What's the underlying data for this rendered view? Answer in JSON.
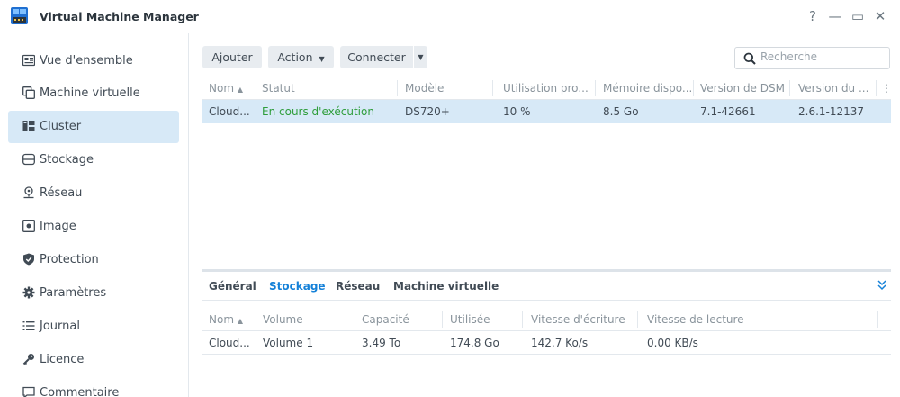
{
  "app": {
    "title": "Virtual Machine Manager"
  },
  "window_controls": {
    "help": "?",
    "minimize": "—",
    "maximize": "▭",
    "close": "✕"
  },
  "sidebar": {
    "items": [
      {
        "label": "Vue d'ensemble",
        "icon": "overview-icon"
      },
      {
        "label": "Machine virtuelle",
        "icon": "vm-icon"
      },
      {
        "label": "Cluster",
        "icon": "cluster-icon",
        "active": true
      },
      {
        "label": "Stockage",
        "icon": "storage-icon"
      },
      {
        "label": "Réseau",
        "icon": "network-icon"
      },
      {
        "label": "Image",
        "icon": "image-icon"
      },
      {
        "label": "Protection",
        "icon": "shield-icon"
      },
      {
        "label": "Paramètres",
        "icon": "gear-icon"
      },
      {
        "label": "Journal",
        "icon": "list-icon"
      },
      {
        "label": "Licence",
        "icon": "key-icon"
      },
      {
        "label": "Commentaire",
        "icon": "comment-icon"
      }
    ]
  },
  "toolbar": {
    "add_label": "Ajouter",
    "action_label": "Action",
    "connect_label": "Connecter",
    "search_placeholder": "Recherche"
  },
  "cluster_table": {
    "columns": [
      "Nom",
      "Statut",
      "Modèle",
      "Utilisation pro...",
      "Mémoire dispo...",
      "Version de DSM",
      "Version du ..."
    ],
    "rows": [
      [
        "Cloud...",
        "En cours d'exécution",
        "DS720+",
        "10 %",
        "8.5 Go",
        "7.1-42661",
        "2.6.1-12137"
      ]
    ]
  },
  "detail_tabs": [
    "Général",
    "Stockage",
    "Réseau",
    "Machine virtuelle"
  ],
  "active_detail_tab": "Stockage",
  "storage_table": {
    "columns": [
      "Nom",
      "Volume",
      "Capacité",
      "Utilisée",
      "Vitesse d'écriture",
      "Vitesse de lecture"
    ],
    "rows": [
      [
        "Cloud...",
        "Volume 1",
        "3.49 To",
        "174.8 Go",
        "142.7 Ko/s",
        "0.00 KB/s"
      ]
    ]
  },
  "colors": {
    "accent": "#1581d8",
    "selected_row": "#d7e9f7",
    "running_status": "#2e9d3a"
  }
}
